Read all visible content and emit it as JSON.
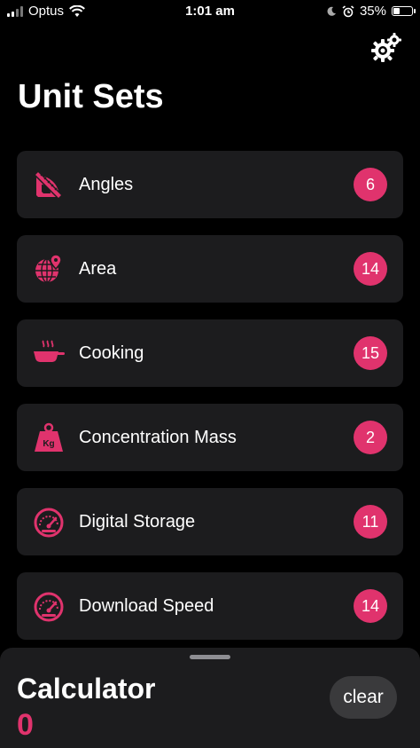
{
  "status_bar": {
    "carrier": "Optus",
    "time": "1:01 am",
    "battery_percent": "35%",
    "battery_level": 0.35
  },
  "header": {
    "title": "Unit Sets",
    "settings_icon": "gear-icon"
  },
  "unit_sets": [
    {
      "label": "Angles",
      "count": "6",
      "icon": "protractor-icon"
    },
    {
      "label": "Area",
      "count": "14",
      "icon": "globe-pin-icon"
    },
    {
      "label": "Cooking",
      "count": "15",
      "icon": "frying-pan-icon"
    },
    {
      "label": "Concentration Mass",
      "count": "2",
      "icon": "kg-weight-icon"
    },
    {
      "label": "Digital Storage",
      "count": "11",
      "icon": "speedometer-icon"
    },
    {
      "label": "Download Speed",
      "count": "14",
      "icon": "speedometer-icon"
    }
  ],
  "calculator": {
    "title": "Calculator",
    "value": "0",
    "clear_label": "clear"
  },
  "colors": {
    "accent": "#e0336d",
    "background": "#000000",
    "card": "#1c1c1e"
  }
}
